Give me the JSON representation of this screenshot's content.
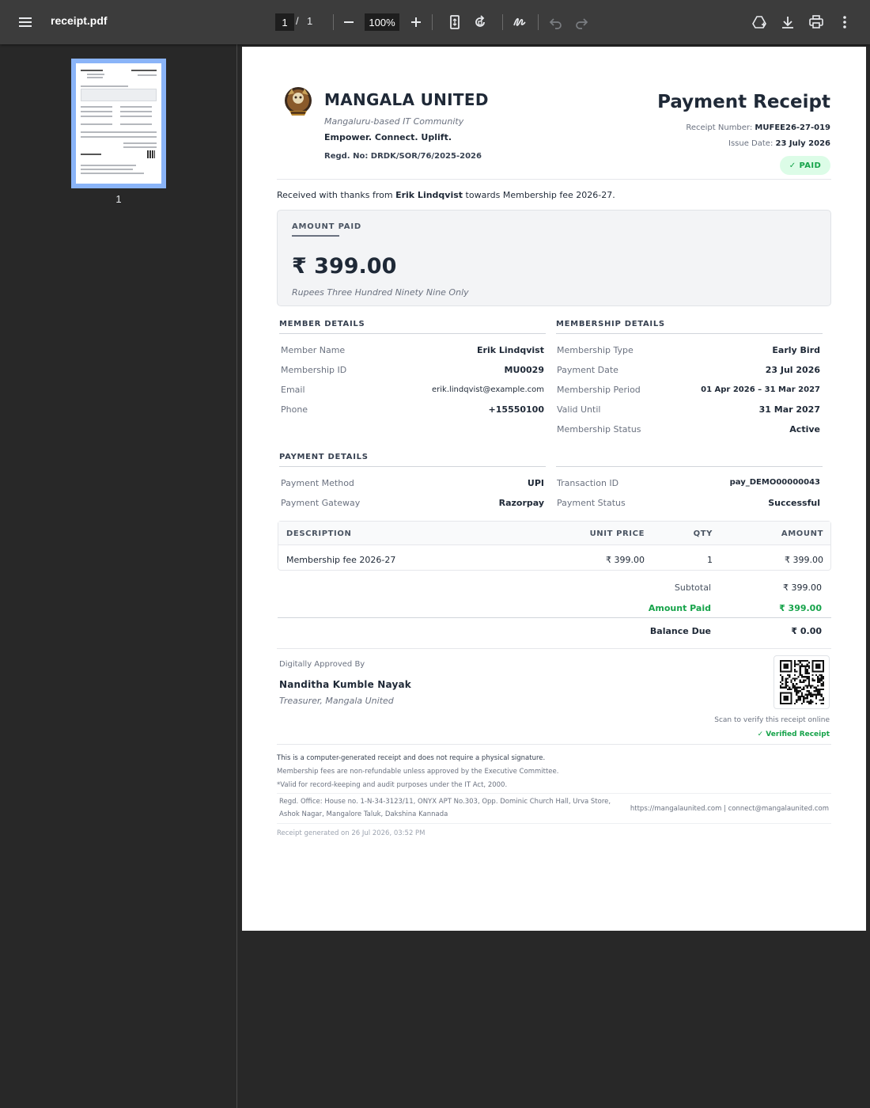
{
  "toolbar": {
    "file_name": "receipt.pdf",
    "current_page": "1",
    "page_separator": "/",
    "total_pages": "1",
    "zoom": "100%",
    "icons": [
      "menu-icon",
      "zoom-out-icon",
      "zoom-in-icon",
      "fit-page-icon",
      "rotate-icon",
      "annotate-icon",
      "undo-icon",
      "redo-icon",
      "drive-icon",
      "download-icon",
      "print-icon",
      "more-icon"
    ]
  },
  "sidebar": {
    "thumbnail_label": "1"
  },
  "receipt": {
    "org": {
      "name": "MANGALA UNITED",
      "tagline": "Mangaluru-based IT Community",
      "slogan": "Empower. Connect. Uplift.",
      "regd": "Regd. No: DRDK/SOR/76/2025-2026"
    },
    "title": "Payment Receipt",
    "receipt_number_label": "Receipt Number: ",
    "receipt_number": "MUFEE26-27-019",
    "issue_date_label": "Issue Date: ",
    "issue_date": "23 July 2026",
    "paid_badge": "✓ PAID",
    "received": {
      "prefix": "Received with thanks from ",
      "name": "Erik Lindqvist",
      "suffix": " towards Membership fee 2026-27."
    },
    "amount": {
      "label": "AMOUNT PAID",
      "value": "₹ 399.00",
      "words": "Rupees Three Hundred Ninety Nine Only"
    },
    "member_details": {
      "heading": "MEMBER DETAILS",
      "rows": [
        {
          "label": "Member Name",
          "value": "Erik Lindqvist"
        },
        {
          "label": "Membership ID",
          "value": "MU0029"
        },
        {
          "label": "Email",
          "value": "erik.lindqvist@example.com"
        },
        {
          "label": "Phone",
          "value": "+15550100"
        }
      ]
    },
    "membership_details": {
      "heading": "MEMBERSHIP DETAILS",
      "rows": [
        {
          "label": "Membership Type",
          "value": "Early Bird"
        },
        {
          "label": "Payment Date",
          "value": "23 Jul 2026"
        },
        {
          "label": "Membership Period",
          "value": "01 Apr 2026 – 31 Mar 2027"
        },
        {
          "label": "Valid Until",
          "value": "31 Mar 2027"
        },
        {
          "label": "Membership Status",
          "value": "Active"
        }
      ]
    },
    "payment_details": {
      "heading": "PAYMENT DETAILS",
      "left": [
        {
          "label": "Payment Method",
          "value": "UPI"
        },
        {
          "label": "Payment Gateway",
          "value": "Razorpay"
        }
      ],
      "right": [
        {
          "label": "Transaction ID",
          "value": "pay_DEMO00000043"
        },
        {
          "label": "Payment Status",
          "value": "Successful"
        }
      ]
    },
    "items": {
      "headers": {
        "description": "DESCRIPTION",
        "unit_price": "UNIT PRICE",
        "qty": "QTY",
        "amount": "AMOUNT"
      },
      "rows": [
        {
          "description": "Membership fee 2026-27",
          "unit_price": "₹ 399.00",
          "qty": "1",
          "amount": "₹ 399.00"
        }
      ]
    },
    "totals": {
      "subtotal_label": "Subtotal",
      "subtotal": "₹ 399.00",
      "amount_paid_label": "Amount Paid",
      "amount_paid": "₹ 399.00",
      "balance_label": "Balance Due",
      "balance": "₹ 0.00"
    },
    "signature": {
      "label": "Digitally Approved By",
      "name": "Nanditha Kumble Nayak",
      "title": "Treasurer, Mangala United"
    },
    "qr": {
      "caption": "Scan to verify this receipt online",
      "verified": "✓ Verified Receipt"
    },
    "footer": {
      "notes": [
        "This is a computer-generated receipt and does not require a physical signature.",
        "Membership fees are non-refundable unless approved by the Executive Committee.",
        "*Valid for record-keeping and audit purposes under the IT Act, 2000."
      ],
      "office_line1": "Regd. Office: House no. 1-N-34-3123/11, ONYX APT No.303, Opp. Dominic Church Hall, Urva Store,",
      "office_line2": "Ashok Nagar, Mangalore Taluk, Dakshina Kannada",
      "contact": "https://mangalaunited.com  |  connect@mangalaunited.com",
      "generated": "Receipt generated on 26 Jul 2026, 03:52 PM"
    },
    "colors": {
      "accent_green": "#16a34a",
      "paid_badge_bg": "#dcfce7",
      "text_dark": "#1f2937"
    }
  }
}
